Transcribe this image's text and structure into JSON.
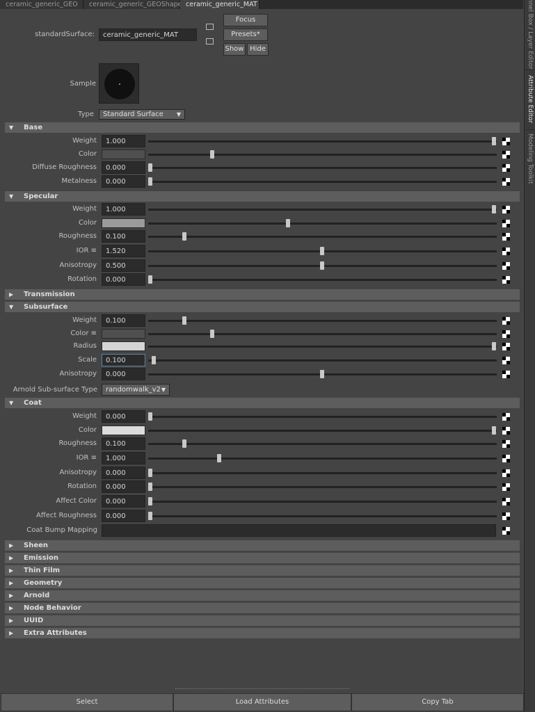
{
  "tabs": [
    {
      "label": "ceramic_generic_GEO",
      "active": false
    },
    {
      "label": "ceramic_generic_GEOShape",
      "active": false
    },
    {
      "label": "ceramic_generic_MAT",
      "active": true
    }
  ],
  "side_tabs": [
    "Channel Box / Layer Editor",
    "Attribute Editor",
    "Modeling Toolkit"
  ],
  "header": {
    "node_type_label": "standardSurface:",
    "node_name": "ceramic_generic_MAT",
    "focus_label": "Focus",
    "presets_label": "Presets*",
    "show_label": "Show",
    "hide_label": "Hide",
    "sample_label": "Sample",
    "type_label": "Type",
    "type_value": "Standard Surface"
  },
  "sections": {
    "base": {
      "title": "Base",
      "expanded": true,
      "rows": [
        {
          "label": "Weight",
          "value": "1.000",
          "slider": 1.0
        },
        {
          "label": "Color",
          "swatch": "#4f4f4f",
          "slider": 0.18
        },
        {
          "label": "Diffuse Roughness",
          "value": "0.000",
          "slider": 0.0
        },
        {
          "label": "Metalness",
          "value": "0.000",
          "slider": 0.0
        }
      ]
    },
    "specular": {
      "title": "Specular",
      "expanded": true,
      "rows": [
        {
          "label": "Weight",
          "value": "1.000",
          "slider": 1.0
        },
        {
          "label": "Color",
          "swatch": "#9b9b9b",
          "slider": 0.4
        },
        {
          "label": "Roughness",
          "value": "0.100",
          "slider": 0.1
        },
        {
          "label": "IOR ≡",
          "value": "1.520",
          "slider": 0.5
        },
        {
          "label": "Anisotropy",
          "value": "0.500",
          "slider": 0.5
        },
        {
          "label": "Rotation",
          "value": "0.000",
          "slider": 0.0
        }
      ]
    },
    "transmission": {
      "title": "Transmission",
      "expanded": false
    },
    "subsurface": {
      "title": "Subsurface",
      "expanded": true,
      "rows": [
        {
          "label": "Weight",
          "value": "0.100",
          "slider": 0.1
        },
        {
          "label": "Color ≡",
          "swatch": "#4f4f4f",
          "slider": 0.18
        },
        {
          "label": "Radius",
          "swatch": "#d5d5d5",
          "slider": 1.0
        },
        {
          "label": "Scale",
          "value": "0.100",
          "slider": 0.01,
          "focused": true
        },
        {
          "label": "Anisotropy",
          "value": "0.000",
          "slider": 0.5
        }
      ],
      "sss_type_label": "Arnold Sub-surface Type",
      "sss_type_value": "randomwalk_v2"
    },
    "coat": {
      "title": "Coat",
      "expanded": true,
      "rows": [
        {
          "label": "Weight",
          "value": "0.000",
          "slider": 0.0
        },
        {
          "label": "Color",
          "swatch": "#dcdcdc",
          "slider": 1.0
        },
        {
          "label": "Roughness",
          "value": "0.100",
          "slider": 0.1
        },
        {
          "label": "IOR ≡",
          "value": "1.000",
          "slider": 0.2
        },
        {
          "label": "Anisotropy",
          "value": "0.000",
          "slider": 0.0
        },
        {
          "label": "Rotation",
          "value": "0.000",
          "slider": 0.0
        },
        {
          "label": "Affect Color",
          "value": "0.000",
          "slider": 0.0
        },
        {
          "label": "Affect Roughness",
          "value": "0.000",
          "slider": 0.0
        }
      ],
      "bump_label": "Coat Bump Mapping"
    },
    "collapsed": [
      "Sheen",
      "Emission",
      "Thin Film",
      "Geometry",
      "Arnold",
      "Node Behavior",
      "UUID",
      "Extra Attributes"
    ]
  },
  "buttons": {
    "select": "Select",
    "load": "Load Attributes",
    "copy": "Copy Tab"
  },
  "colors": {
    "panel": "#444444",
    "header_bar": "#5d5d5d",
    "field": "#2b2b2b",
    "focus": "#5a86a8"
  }
}
